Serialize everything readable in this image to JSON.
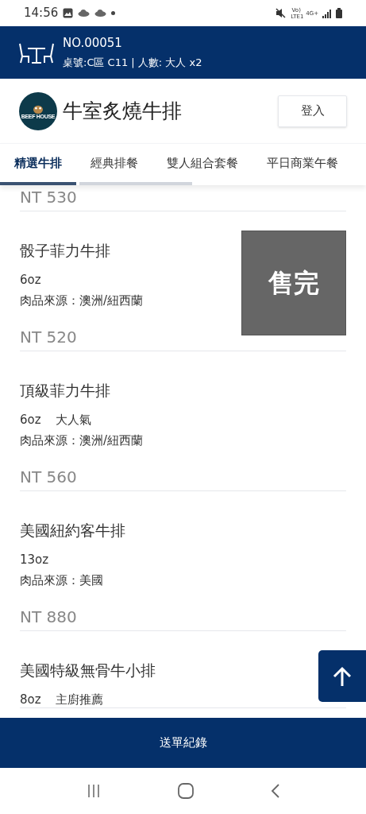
{
  "status_bar": {
    "time": "14:56",
    "network": "Vo) LTE1",
    "data": "4G+"
  },
  "order_header": {
    "number": "NO.00051",
    "details": "桌號:C區 C11 | 人數: 大人 x2"
  },
  "brand": {
    "logo_text": "BEEF HOUSE",
    "name": "牛室炙燒牛排",
    "login_button": "登入"
  },
  "tabs": [
    {
      "label": "精選牛排",
      "selected": true
    },
    {
      "label": "經典排餐",
      "selected": false
    },
    {
      "label": "雙人組合套餐",
      "selected": false
    },
    {
      "label": "平日商業午餐",
      "selected": false
    }
  ],
  "menu_items": [
    {
      "price": "NT 530"
    },
    {
      "name": "骰子菲力牛排",
      "tags": [
        "6oz"
      ],
      "source": "肉品來源：澳洲/紐西蘭",
      "price": "NT 520",
      "sold_out": true,
      "sold_out_label": "售完"
    },
    {
      "name": "頂級菲力牛排",
      "tags": [
        "6oz",
        "大人氣"
      ],
      "source": "肉品來源：澳洲/紐西蘭",
      "price": "NT 560",
      "sold_out": false
    },
    {
      "name": "美國紐約客牛排",
      "tags": [
        "13oz"
      ],
      "source": "肉品來源：美國",
      "price": "NT 880",
      "sold_out": false
    },
    {
      "name": "美國特級無骨牛小排",
      "tags": [
        "8oz",
        "主廚推薦"
      ]
    }
  ],
  "order_history_button": "送單紀錄"
}
